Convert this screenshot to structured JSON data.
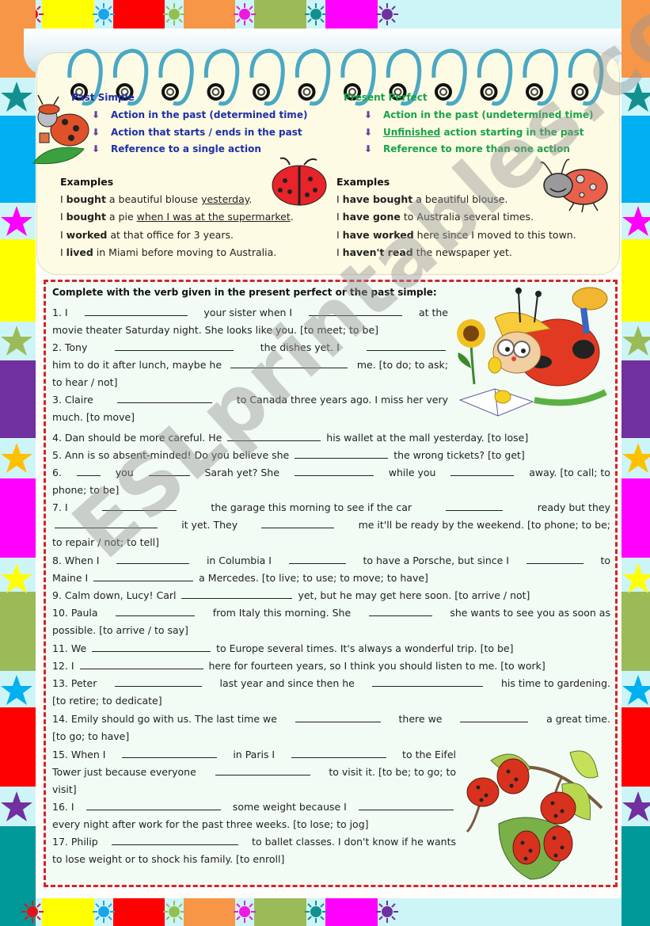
{
  "theory": {
    "past_simple": {
      "title": "Past Simple",
      "points": [
        "Action in the past (determined time)",
        "Action that starts / ends in the past",
        "Reference to a single action"
      ],
      "examples_title": "Examples",
      "examples": [
        {
          "pre": "I ",
          "bold": "bought",
          "mid": " a beautiful blouse ",
          "under": "yesterday",
          "post": "."
        },
        {
          "pre": "I ",
          "bold": "bought",
          "mid": " a pie ",
          "under": "when I was at the supermarket",
          "post": "."
        },
        {
          "pre": "I ",
          "bold": "worked",
          "mid": " at that office for 3 years.",
          "under": "",
          "post": ""
        },
        {
          "pre": "I ",
          "bold": "lived",
          "mid": " in Miami before moving to Australia.",
          "under": "",
          "post": ""
        }
      ]
    },
    "present_perfect": {
      "title": "Present Perfect",
      "points": [
        {
          "under": "",
          "text": "Action in the past (undetermined time)"
        },
        {
          "under": "Unfinished",
          "text": " action starting in the past"
        },
        {
          "under": "",
          "text": "Reference to more than one action"
        }
      ],
      "examples_title": "Examples",
      "examples": [
        {
          "pre": "I ",
          "bold": "have bought",
          "post": " a beautiful blouse."
        },
        {
          "pre": "I ",
          "bold": "have gone",
          "post": " to Australia several times."
        },
        {
          "pre": "I ",
          "bold": "have worked",
          "post": " here since I moved to this town."
        },
        {
          "pre": "I ",
          "bold": "haven't read",
          "post": " the newspaper yet."
        }
      ]
    }
  },
  "exercise": {
    "instruction": "Complete with the verb given in the present perfect or the past simple:",
    "lines": [
      [
        "1. I ",
        "B130",
        " your sister when I ",
        "B118",
        " at the"
      ],
      [
        "movie theater Saturday night. She looks like you. [to meet; to be]"
      ],
      [
        "2. Tony ",
        "B150",
        " the dishes yet. I ",
        "B100"
      ],
      [
        "him to do it after lunch, maybe he ",
        "B148",
        " me. [to do; to ask;"
      ],
      [
        "to hear / not]"
      ],
      [
        "3. Claire ",
        "B120",
        " to Canada three years ago. I miss her very"
      ],
      [
        "much. [to move]"
      ],
      [
        "4. Dan should be more careful. He ",
        "B118",
        " his wallet at the mall yesterday. [to lose]"
      ],
      [
        "5. Ann is so absent-minded! Do you believe she ",
        "B118",
        " the wrong tickets? [to get]"
      ],
      [
        "6. ",
        "B30",
        " you ",
        "B52",
        " Sarah yet? She ",
        "B100",
        " while you ",
        "B80",
        " away. [to call; to"
      ],
      [
        "phone; to be]"
      ],
      [
        "7. I ",
        "B94",
        " the garage this morning to see if the car ",
        "B72",
        " ready but they"
      ],
      [
        "B130",
        " it yet. They ",
        "B92",
        " me it'll be ready by the weekend. [to phone; to be;"
      ],
      [
        "to repair / not; to tell]"
      ],
      [
        "8. When I ",
        "B92",
        " in Columbia I ",
        "B72",
        " to have a Porsche, but since I ",
        "B72",
        " to"
      ],
      [
        "Maine I ",
        "B126",
        " a Mercedes. [to live; to use; to move; to have]"
      ],
      [
        "9. Calm down, Lucy! Carl ",
        "B140",
        " yet, but he may get here soon. [to arrive / not]"
      ],
      [
        "10. Paula ",
        "B100",
        " from Italy this morning. She ",
        "B80",
        " she wants to see you as soon as"
      ],
      [
        "possible. [to arrive / to say]"
      ],
      [
        "11. We ",
        "B150",
        " to Europe several times. It's always a wonderful trip. [to be]"
      ],
      [
        "12. I ",
        "B156",
        " here for fourteen years, so I think you should listen to me. [to work]"
      ],
      [
        "13. Peter ",
        "B110",
        " last year and since then he ",
        "B140",
        " his time to gardening."
      ],
      [
        "[to retire; to dedicate]"
      ],
      [
        "14. Emily should go with us. The last time we ",
        "B108",
        " there we ",
        "B86",
        " a great time."
      ],
      [
        "[to go; to have]"
      ],
      [
        "15. When I ",
        "B120",
        " in Paris I ",
        "B120",
        " to the Eifel"
      ],
      [
        "Tower just because everyone ",
        "B120",
        " to visit it. [to be; to go; to"
      ],
      [
        "visit]"
      ],
      [
        "16. I ",
        "B170",
        " some weight because I ",
        "B120"
      ],
      [
        "every night after work for the past three weeks. [to lose; to jog]"
      ],
      [
        "17. Philip ",
        "B160",
        " to ballet classes. I don't know if he wants"
      ],
      [
        "to lose weight or to shock his family. [to enroll]"
      ]
    ]
  },
  "watermark": "ESLprintables.com",
  "border_colors": {
    "top": [
      "#ffff00",
      "#ff0000",
      "#f79646",
      "#9bbb59",
      "#ff00ff"
    ],
    "suns": [
      "#e0141e",
      "#1aa6e6",
      "#92c050",
      "#ee18e0",
      "#129090",
      "#7030a0"
    ],
    "side": [
      "#f79646",
      "#00b0f0",
      "#ffff00",
      "#7030a0",
      "#ff00ff",
      "#9bbb59",
      "#ff0000",
      "#009999"
    ],
    "stars": [
      "#129090",
      "#ff00ff",
      "#9bbb59",
      "#ffc000",
      "#ffff00",
      "#00b0f0",
      "#7030a0"
    ]
  }
}
